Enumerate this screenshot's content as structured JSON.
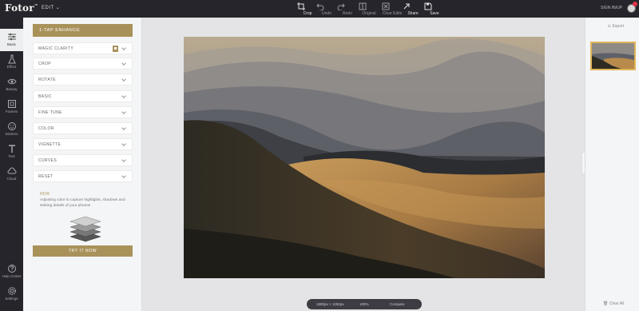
{
  "header": {
    "logo": "Fotor",
    "logo_mark": "™",
    "edit_menu": "EDIT",
    "tools": [
      {
        "label": "Crop",
        "icon": "crop-icon",
        "active": true
      },
      {
        "label": "Undo",
        "icon": "undo-icon",
        "active": false
      },
      {
        "label": "Redo",
        "icon": "redo-icon",
        "active": false
      },
      {
        "label": "Original",
        "icon": "original-icon",
        "active": false
      },
      {
        "label": "Clear Edits",
        "icon": "clear-edits-icon",
        "active": false
      },
      {
        "label": "Share",
        "icon": "share-icon",
        "active": true
      },
      {
        "label": "Save",
        "icon": "save-icon",
        "active": true
      }
    ],
    "sign_in": "SIGN IN/UP"
  },
  "sidebar": {
    "items": [
      {
        "label": "Basic",
        "icon": "sliders-icon",
        "active": true
      },
      {
        "label": "Effect",
        "icon": "flask-icon",
        "active": false
      },
      {
        "label": "Beauty",
        "icon": "eye-icon",
        "active": false
      },
      {
        "label": "Frames",
        "icon": "frame-icon",
        "active": false
      },
      {
        "label": "Stickers",
        "icon": "sticker-icon",
        "active": false
      },
      {
        "label": "Text",
        "icon": "text-icon",
        "active": false
      },
      {
        "label": "Cloud",
        "icon": "cloud-icon",
        "active": false
      },
      {
        "label": "Help Center",
        "icon": "help-icon",
        "active": false
      },
      {
        "label": "Settings",
        "icon": "gear-icon",
        "active": false
      }
    ]
  },
  "panel": {
    "title": "1-TAP ENHANCE",
    "sections": [
      {
        "label": "MAGIC CLARITY",
        "premium": true
      },
      {
        "label": "CROP",
        "premium": false
      },
      {
        "label": "ROTATE",
        "premium": false
      },
      {
        "label": "BASIC",
        "premium": false
      },
      {
        "label": "FINE TUNE",
        "premium": false
      },
      {
        "label": "COLOR",
        "premium": false
      },
      {
        "label": "VIGNETTE",
        "premium": false
      },
      {
        "label": "CURVES",
        "premium": false
      },
      {
        "label": "RESET",
        "premium": false
      }
    ],
    "tip_title": "HDR",
    "tip_text": "Adjusting color to capture highlights, shadows and striking details of your photos!",
    "try_button": "TRY IT NOW"
  },
  "canvas": {
    "dimensions": "1880px × 1250px",
    "zoom": "100%",
    "compare": "Compare"
  },
  "right_panel": {
    "export": "Export",
    "clear_all": "Clear All"
  },
  "colors": {
    "accent_gold": "#a9925a",
    "topbar": "#25252b",
    "thumb_border": "#e0b55a"
  }
}
